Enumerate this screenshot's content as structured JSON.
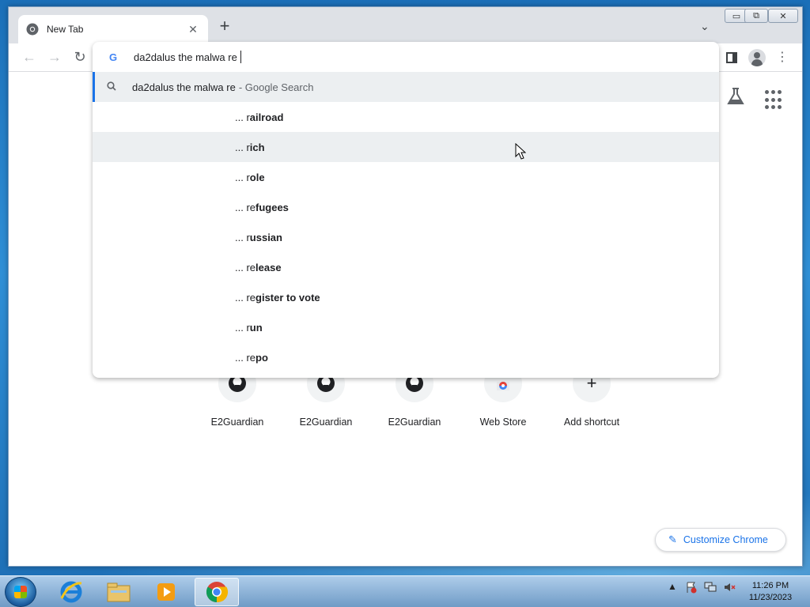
{
  "tab": {
    "title": "New Tab",
    "close": "✕",
    "new_tab": "+",
    "tab_search": "⌄"
  },
  "window_controls": {
    "minimize": "▭",
    "maximize": "⧉",
    "close": "✕"
  },
  "toolbar": {
    "back": "←",
    "forward": "→",
    "reload": "↻"
  },
  "omnibox": {
    "input_value": "da2dalus the malwa re",
    "search_engine_icon": "G",
    "top_suggestion": {
      "text": "da2dalus the malwa re",
      "suffix": "- Google Search"
    },
    "suggestions": [
      {
        "prefix": "... ",
        "plain": "r",
        "bold": "ailroad"
      },
      {
        "prefix": "... ",
        "plain": "r",
        "bold": "ich"
      },
      {
        "prefix": "... ",
        "plain": "r",
        "bold": "ole"
      },
      {
        "prefix": "... ",
        "plain": "re",
        "bold": "fugees"
      },
      {
        "prefix": "... ",
        "plain": "r",
        "bold": "ussian"
      },
      {
        "prefix": "... ",
        "plain": "re",
        "bold": "lease"
      },
      {
        "prefix": "... ",
        "plain": "re",
        "bold": "gister to vote"
      },
      {
        "prefix": "... ",
        "plain": "r",
        "bold": "un"
      },
      {
        "prefix": "... ",
        "plain": "re",
        "bold": "po"
      }
    ],
    "hovered_index": 1
  },
  "shortcuts": [
    {
      "label": "E2Guardian",
      "icon": "github-icon"
    },
    {
      "label": "E2Guardian",
      "icon": "github-icon"
    },
    {
      "label": "E2Guardian",
      "icon": "github-icon"
    },
    {
      "label": "Web Store",
      "icon": "chrome-webstore-icon"
    },
    {
      "label": "Add shortcut",
      "icon": "plus-icon",
      "glyph": "+"
    }
  ],
  "customize": {
    "label": "Customize Chrome"
  },
  "taskbar": {
    "apps": [
      "internet-explorer-icon",
      "file-explorer-icon",
      "media-player-icon",
      "chrome-icon"
    ],
    "active_app": "chrome-icon",
    "tray_expand": "▲",
    "clock_time": "11:26 PM",
    "clock_date": "11/23/2023"
  }
}
